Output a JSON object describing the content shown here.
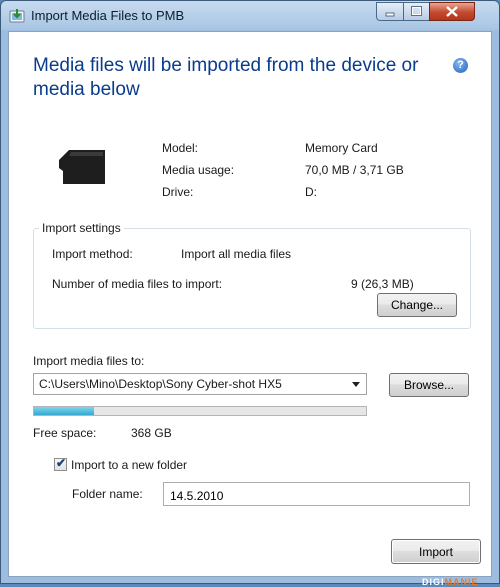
{
  "window": {
    "title": "Import Media Files to PMB"
  },
  "heading": {
    "text": "Media files will be imported from the device or media below"
  },
  "device": {
    "model_label": "Model:",
    "model_value": "Memory Card",
    "usage_label": "Media usage:",
    "usage_value": "70,0 MB / 3,71 GB",
    "drive_label": "Drive:",
    "drive_value": "D:"
  },
  "import_settings": {
    "title": "Import settings",
    "method_label": "Import method:",
    "method_value": "Import all media files",
    "count_label": "Number of media files to import:",
    "count_value": "9 (26,3 MB)",
    "change_button": "Change..."
  },
  "destination": {
    "label": "Import media files to:",
    "path": "C:\\Users\\Mino\\Desktop\\Sony Cyber-shot HX5",
    "browse_button": "Browse...",
    "space_used_fraction": 0.18,
    "free_space_label": "Free space:",
    "free_space_value": "368 GB"
  },
  "new_folder": {
    "checkbox_label": "Import to a new folder",
    "checked": true,
    "folder_name_label": "Folder name:",
    "folder_name_value": "14.5.2010"
  },
  "footer": {
    "import_button": "Import"
  },
  "watermark": {
    "part1": "DIGI",
    "part2": "MANIE"
  },
  "icons": {
    "app": "import-app-icon",
    "help": "help-icon",
    "device": "memory-card-icon"
  },
  "colors": {
    "heading": "#0a3c8c",
    "progress": "#35a9cf",
    "close_button": "#c44a30"
  }
}
